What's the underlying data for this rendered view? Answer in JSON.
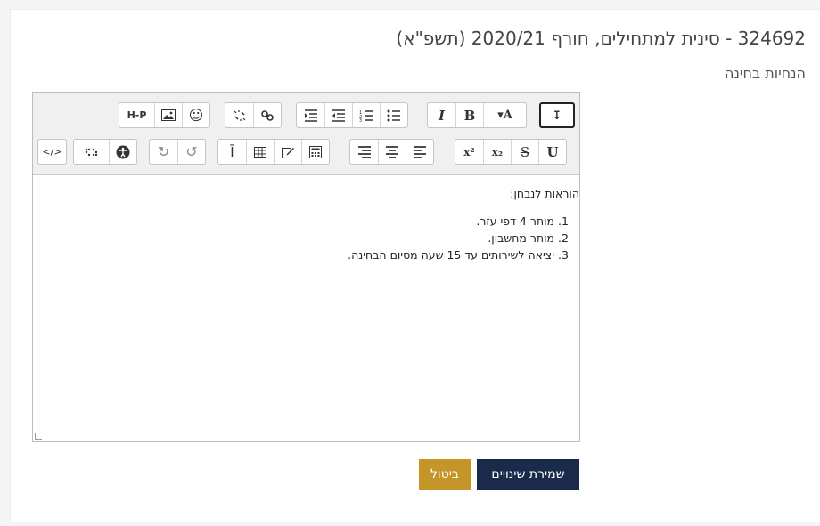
{
  "page": {
    "course_title": "324692 - סינית למתחילים, חורף 2020/21 (תשפ\"א)",
    "section_title": "הנחיות בחינה"
  },
  "editor": {
    "toolbar_row1": [
      {
        "name": "h5p-icon",
        "label": "H-P"
      },
      {
        "name": "image-icon"
      },
      {
        "name": "emoji-icon",
        "label": "☺"
      },
      {
        "name": "unlink-icon"
      },
      {
        "name": "link-icon"
      },
      {
        "name": "indent-icon"
      },
      {
        "name": "outdent-icon"
      },
      {
        "name": "ordered-list-icon"
      },
      {
        "name": "unordered-list-icon"
      },
      {
        "name": "italic-icon",
        "label": "I"
      },
      {
        "name": "bold-icon",
        "label": "B"
      },
      {
        "name": "font-size-icon",
        "label": "▾A"
      },
      {
        "name": "toggle-toolbar-icon",
        "label": "↧"
      }
    ],
    "toolbar_row2": [
      {
        "name": "html-source-icon",
        "label": "</>"
      },
      {
        "name": "braille-icon"
      },
      {
        "name": "accessibility-icon"
      },
      {
        "name": "redo-icon",
        "label": "↻"
      },
      {
        "name": "undo-icon",
        "label": "↺"
      },
      {
        "name": "clear-format-icon",
        "label": "Ī"
      },
      {
        "name": "table-icon"
      },
      {
        "name": "edit-icon"
      },
      {
        "name": "calculator-icon"
      },
      {
        "name": "align-right-icon"
      },
      {
        "name": "align-center-icon"
      },
      {
        "name": "align-left-icon"
      },
      {
        "name": "superscript-icon",
        "label": "x²"
      },
      {
        "name": "subscript-icon",
        "label": "x₂"
      },
      {
        "name": "strikethrough-icon",
        "label": "S"
      },
      {
        "name": "underline-icon",
        "label": "U"
      }
    ],
    "content": {
      "heading": "הוראות לנבחן:",
      "items": [
        "מותר 4 דפי עזר.",
        "מותר מחשבון.",
        "יציאה לשירותים עד 15 שעה מסיום הבחינה."
      ]
    }
  },
  "actions": {
    "save_label": "שמירת שינויים",
    "cancel_label": "ביטול"
  },
  "colors": {
    "save_bg": "#1a2a4a",
    "cancel_bg": "#c5952a"
  }
}
